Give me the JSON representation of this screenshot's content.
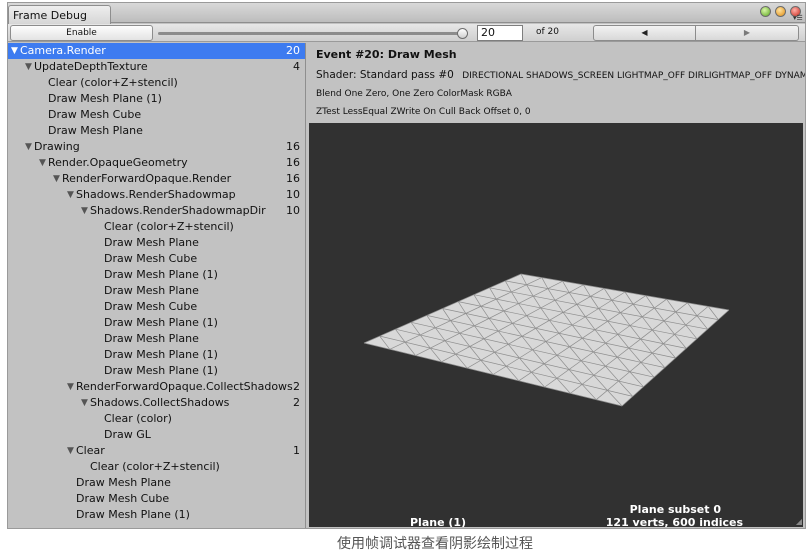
{
  "window": {
    "tab_title": "Frame Debug",
    "menu_icon": "menu-icon"
  },
  "toolbar": {
    "enable_label": "Enable",
    "slider_fraction": 1.0,
    "current_event": "20",
    "of_label": "of 20",
    "prev_glyph": "◀",
    "next_glyph": "▶"
  },
  "tree": [
    {
      "label": "Camera.Render",
      "count": "20",
      "depth": 0,
      "expanded": true,
      "selected": true
    },
    {
      "label": "UpdateDepthTexture",
      "count": "4",
      "depth": 1,
      "expanded": true
    },
    {
      "label": "Clear (color+Z+stencil)",
      "count": "",
      "depth": 2
    },
    {
      "label": "Draw Mesh Plane (1)",
      "count": "",
      "depth": 2
    },
    {
      "label": "Draw Mesh Cube",
      "count": "",
      "depth": 2
    },
    {
      "label": "Draw Mesh Plane",
      "count": "",
      "depth": 2
    },
    {
      "label": "Drawing",
      "count": "16",
      "depth": 1,
      "expanded": true
    },
    {
      "label": "Render.OpaqueGeometry",
      "count": "16",
      "depth": 2,
      "expanded": true
    },
    {
      "label": "RenderForwardOpaque.Render",
      "count": "16",
      "depth": 3,
      "expanded": true
    },
    {
      "label": "Shadows.RenderShadowmap",
      "count": "10",
      "depth": 4,
      "expanded": true
    },
    {
      "label": "Shadows.RenderShadowmapDir",
      "count": "10",
      "depth": 5,
      "expanded": true
    },
    {
      "label": "Clear (color+Z+stencil)",
      "count": "",
      "depth": 6
    },
    {
      "label": "Draw Mesh Plane",
      "count": "",
      "depth": 6
    },
    {
      "label": "Draw Mesh Cube",
      "count": "",
      "depth": 6
    },
    {
      "label": "Draw Mesh Plane (1)",
      "count": "",
      "depth": 6
    },
    {
      "label": "Draw Mesh Plane",
      "count": "",
      "depth": 6
    },
    {
      "label": "Draw Mesh Cube",
      "count": "",
      "depth": 6
    },
    {
      "label": "Draw Mesh Plane (1)",
      "count": "",
      "depth": 6
    },
    {
      "label": "Draw Mesh Plane",
      "count": "",
      "depth": 6
    },
    {
      "label": "Draw Mesh Plane (1)",
      "count": "",
      "depth": 6
    },
    {
      "label": "Draw Mesh Plane (1)",
      "count": "",
      "depth": 6
    },
    {
      "label": "RenderForwardOpaque.CollectShadows",
      "count": "2",
      "depth": 4,
      "expanded": true
    },
    {
      "label": "Shadows.CollectShadows",
      "count": "2",
      "depth": 5,
      "expanded": true
    },
    {
      "label": "Clear (color)",
      "count": "",
      "depth": 6
    },
    {
      "label": "Draw GL",
      "count": "",
      "depth": 6
    },
    {
      "label": "Clear",
      "count": "1",
      "depth": 4,
      "expanded": true
    },
    {
      "label": "Clear (color+Z+stencil)",
      "count": "",
      "depth": 5
    },
    {
      "label": "Draw Mesh Plane",
      "count": "",
      "depth": 4
    },
    {
      "label": "Draw Mesh Cube",
      "count": "",
      "depth": 4
    },
    {
      "label": "Draw Mesh Plane (1)",
      "count": "",
      "depth": 4
    }
  ],
  "details": {
    "event_title": "Event #20: Draw Mesh",
    "shader_text": "Shader: Standard pass #0",
    "shader_keywords": "DIRECTIONAL SHADOWS_SCREEN LIGHTMAP_OFF DIRLIGHTMAP_OFF DYNAM",
    "blend_text": "Blend One Zero, One Zero ColorMask RGBA",
    "ztest_text": "ZTest LessEqual ZWrite On Cull Back Offset 0, 0",
    "plane_label": "Plane (1)",
    "subset_label": "Plane subset 0",
    "verts_label": "121 verts, 600 indices"
  },
  "colors": {
    "selection": "#3d7bf0",
    "panel_bg": "#c2c2c2",
    "viewport_bg": "#313131",
    "mesh_fill": "#d8d8d8",
    "mesh_line": "#8e8e8e"
  },
  "caption": "使用帧调试器查看阴影绘制过程"
}
